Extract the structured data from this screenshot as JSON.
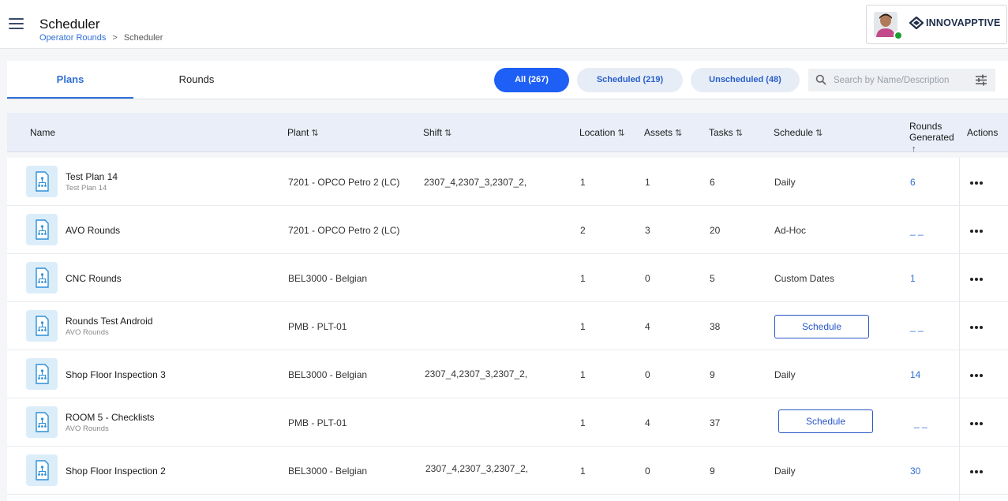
{
  "header": {
    "title": "Scheduler",
    "breadcrumb": {
      "parent": "Operator Rounds",
      "separator": ">",
      "current": "Scheduler"
    },
    "brand": "INNOVAPPTIVE"
  },
  "tabs": [
    {
      "label": "Plans",
      "active": true
    },
    {
      "label": "Rounds",
      "active": false
    }
  ],
  "filters": {
    "all": "All (267)",
    "scheduled": "Scheduled (219)",
    "unscheduled": "Unscheduled (48)"
  },
  "search": {
    "placeholder": "Search by Name/Description",
    "value": ""
  },
  "columns": {
    "name": "Name",
    "plant": "Plant",
    "shift": "Shift",
    "location": "Location",
    "assets": "Assets",
    "tasks": "Tasks",
    "schedule": "Schedule",
    "rounds_generated": "Rounds Generated",
    "actions": "Actions"
  },
  "sort_glyph": "⇅",
  "rows": [
    {
      "name": "Test Plan 14",
      "sub": "Test Plan 14",
      "plant": "7201 - OPCO Petro 2 (LC)",
      "shift": "2307_4,2307_3,2307_2,",
      "location": "1",
      "assets": "1",
      "tasks": "6",
      "schedule": "Daily",
      "rounds": "6"
    },
    {
      "name": "AVO Rounds",
      "sub": "",
      "plant": "7201 - OPCO Petro 2 (LC)",
      "shift": "",
      "location": "2",
      "assets": "3",
      "tasks": "20",
      "schedule": "Ad-Hoc",
      "rounds": "_ _"
    },
    {
      "name": "CNC Rounds",
      "sub": "",
      "plant": "BEL3000 - Belgian",
      "shift": "",
      "location": "1",
      "assets": "0",
      "tasks": "5",
      "schedule": "Custom Dates",
      "rounds": "1"
    },
    {
      "name": "Rounds Test Android",
      "sub": "AVO Rounds",
      "plant": "PMB - PLT-01",
      "shift": "",
      "location": "1",
      "assets": "4",
      "tasks": "38",
      "schedule": "Schedule",
      "rounds": "_ _"
    },
    {
      "name": "Shop Floor Inspection 3",
      "sub": "",
      "plant": "BEL3000 - Belgian",
      "shift": "2307_4,2307_3,2307_2,",
      "location": "1",
      "assets": "0",
      "tasks": "9",
      "schedule": "Daily",
      "rounds": "14"
    },
    {
      "name": "ROOM 5 - Checklists",
      "sub": "AVO Rounds",
      "plant": "PMB - PLT-01",
      "shift": "",
      "location": "1",
      "assets": "4",
      "tasks": "37",
      "schedule": "Schedule",
      "rounds": "_ _"
    },
    {
      "name": "Shop Floor Inspection 2",
      "sub": "",
      "plant": "BEL3000 - Belgian",
      "shift": "2307_4,2307_3,2307_2,",
      "location": "1",
      "assets": "0",
      "tasks": "9",
      "schedule": "Daily",
      "rounds": "30"
    }
  ]
}
